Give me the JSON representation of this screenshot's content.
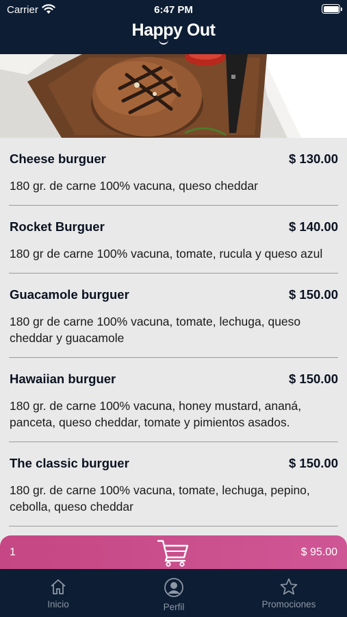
{
  "status_bar": {
    "carrier": "Carrier",
    "time": "6:47 PM"
  },
  "header": {
    "brand": "Happy Out"
  },
  "menu_items": [
    {
      "name": "Cheese burguer",
      "price": "$ 130.00",
      "description": "180 gr. de carne 100% vacuna, queso cheddar"
    },
    {
      "name": "Rocket Burguer",
      "price": "$ 140.00",
      "description": "180 gr de carne 100% vacuna, tomate, rucula y queso azul"
    },
    {
      "name": "Guacamole burguer",
      "price": "$ 150.00",
      "description": "180 gr de carne 100% vacuna, tomate, lechuga, queso cheddar y guacamole"
    },
    {
      "name": "Hawaiian burguer",
      "price": "$ 150.00",
      "description": "180 gr. de carne 100% vacuna, honey mustard, ananá, panceta, queso cheddar, tomate y pimientos asados."
    },
    {
      "name": "The classic burguer",
      "price": "$ 150.00",
      "description": "180 gr. de carne 100% vacuna, tomate, lechuga, pepino, cebolla, queso cheddar"
    }
  ],
  "cart": {
    "count": "1",
    "total": "$ 95.00",
    "icon": "cart-icon"
  },
  "tabs": [
    {
      "label": "Inicio",
      "icon": "home-icon"
    },
    {
      "label": "Perfil",
      "icon": "profile-icon"
    },
    {
      "label": "Promociones",
      "icon": "star-icon"
    }
  ],
  "colors": {
    "nav_background": "#0d1d33",
    "cart_accent": "#c54783",
    "tab_inactive": "#8d97a5"
  }
}
